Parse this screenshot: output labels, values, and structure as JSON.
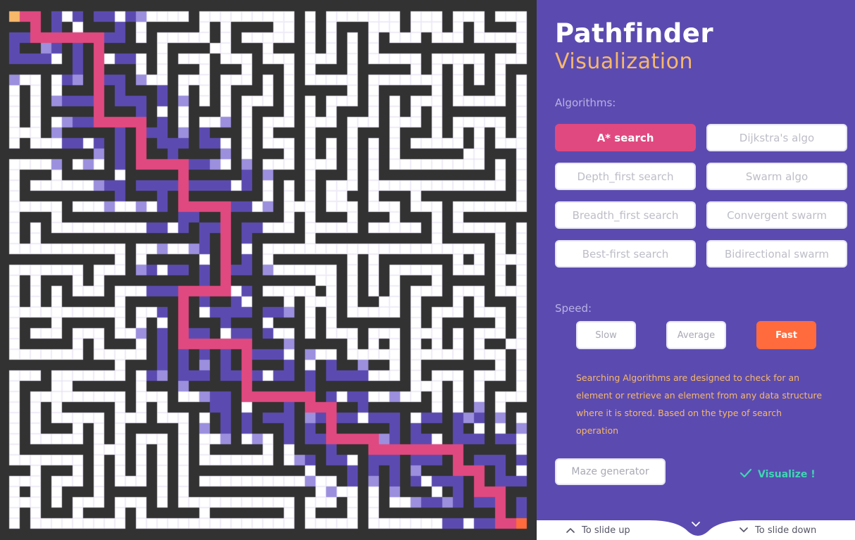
{
  "header": {
    "title": "Pathfinder",
    "subtitle": "Visualization"
  },
  "algorithms": {
    "label": "Algorithms:",
    "items": [
      {
        "label": "A* search",
        "active": true
      },
      {
        "label": "Dijkstra's algo",
        "active": false
      },
      {
        "label": "Depth_first search",
        "active": false
      },
      {
        "label": "Swarm algo",
        "active": false
      },
      {
        "label": "Breadth_first search",
        "active": false
      },
      {
        "label": "Convergent swarm",
        "active": false
      },
      {
        "label": "Best-first search",
        "active": false
      },
      {
        "label": "Bidirectional swarm",
        "active": false
      }
    ]
  },
  "speed": {
    "label": "Speed:",
    "options": [
      {
        "label": "Slow",
        "active": false
      },
      {
        "label": "Average",
        "active": false
      },
      {
        "label": "Fast",
        "active": true
      }
    ]
  },
  "description": "Searching Algorithms are designed to check for an element or retrieve an element from any data structure where it is stored. Based on the type of search operation",
  "actions": {
    "maze_generator": "Maze generator",
    "visualize": "Visualize !",
    "visualize_icon": "check-icon"
  },
  "footer": {
    "slide_up": "To slide up",
    "slide_down": "To slide down",
    "slide_up_icon": "chevron-up-icon",
    "slide_down_icon": "chevron-down-icon"
  },
  "colors": {
    "panel_bg": "#5b4bb0",
    "wall": "#323232",
    "open_cell": "#ffffff",
    "visited": "#5b4bb0",
    "frontier": "#9b8fde",
    "path": "#e0497f",
    "start_node": "#f7b86a",
    "end_node": "#ff6b3d",
    "accent_visualize": "#3fd6b3"
  },
  "maze": {
    "columns": 49,
    "rows": 49,
    "start_cell": [
      0,
      0
    ],
    "end_cell": [
      48,
      48
    ],
    "path_cells": [
      [
        1,
        0
      ],
      [
        2,
        0
      ],
      [
        2,
        1
      ],
      [
        2,
        2
      ],
      [
        3,
        2
      ],
      [
        4,
        2
      ],
      [
        5,
        2
      ],
      [
        6,
        2
      ],
      [
        7,
        2
      ],
      [
        8,
        2
      ],
      [
        8,
        3
      ],
      [
        8,
        4
      ],
      [
        8,
        5
      ],
      [
        8,
        6
      ],
      [
        8,
        7
      ],
      [
        8,
        8
      ],
      [
        8,
        9
      ],
      [
        8,
        10
      ],
      [
        9,
        10
      ],
      [
        10,
        10
      ],
      [
        11,
        10
      ],
      [
        12,
        10
      ],
      [
        12,
        11
      ],
      [
        12,
        12
      ],
      [
        12,
        13
      ],
      [
        12,
        14
      ],
      [
        13,
        14
      ],
      [
        14,
        14
      ],
      [
        15,
        14
      ],
      [
        16,
        14
      ],
      [
        16,
        15
      ],
      [
        16,
        16
      ],
      [
        16,
        17
      ],
      [
        16,
        18
      ],
      [
        17,
        18
      ],
      [
        18,
        18
      ],
      [
        19,
        18
      ],
      [
        20,
        18
      ],
      [
        20,
        19
      ],
      [
        20,
        20
      ],
      [
        20,
        21
      ],
      [
        20,
        22
      ],
      [
        20,
        23
      ],
      [
        20,
        24
      ],
      [
        20,
        25
      ],
      [
        20,
        26
      ],
      [
        19,
        26
      ],
      [
        18,
        26
      ],
      [
        17,
        26
      ],
      [
        16,
        26
      ],
      [
        16,
        27
      ],
      [
        16,
        28
      ],
      [
        16,
        29
      ],
      [
        16,
        30
      ],
      [
        16,
        31
      ],
      [
        17,
        31
      ],
      [
        18,
        31
      ],
      [
        19,
        31
      ],
      [
        20,
        31
      ],
      [
        21,
        31
      ],
      [
        22,
        31
      ],
      [
        22,
        32
      ],
      [
        22,
        33
      ],
      [
        22,
        34
      ],
      [
        22,
        35
      ],
      [
        22,
        36
      ],
      [
        23,
        36
      ],
      [
        24,
        36
      ],
      [
        25,
        36
      ],
      [
        26,
        36
      ],
      [
        27,
        36
      ],
      [
        28,
        36
      ],
      [
        28,
        37
      ],
      [
        29,
        37
      ],
      [
        30,
        37
      ],
      [
        30,
        38
      ],
      [
        30,
        39
      ],
      [
        30,
        40
      ],
      [
        31,
        40
      ],
      [
        32,
        40
      ],
      [
        33,
        40
      ],
      [
        34,
        40
      ],
      [
        34,
        41
      ],
      [
        35,
        41
      ],
      [
        36,
        41
      ],
      [
        37,
        41
      ],
      [
        38,
        41
      ],
      [
        39,
        41
      ],
      [
        40,
        41
      ],
      [
        41,
        41
      ],
      [
        42,
        41
      ],
      [
        42,
        42
      ],
      [
        42,
        43
      ],
      [
        43,
        43
      ],
      [
        44,
        43
      ],
      [
        44,
        44
      ],
      [
        44,
        45
      ],
      [
        45,
        45
      ],
      [
        46,
        45
      ],
      [
        46,
        46
      ],
      [
        46,
        47
      ],
      [
        46,
        48
      ],
      [
        47,
        48
      ]
    ]
  }
}
